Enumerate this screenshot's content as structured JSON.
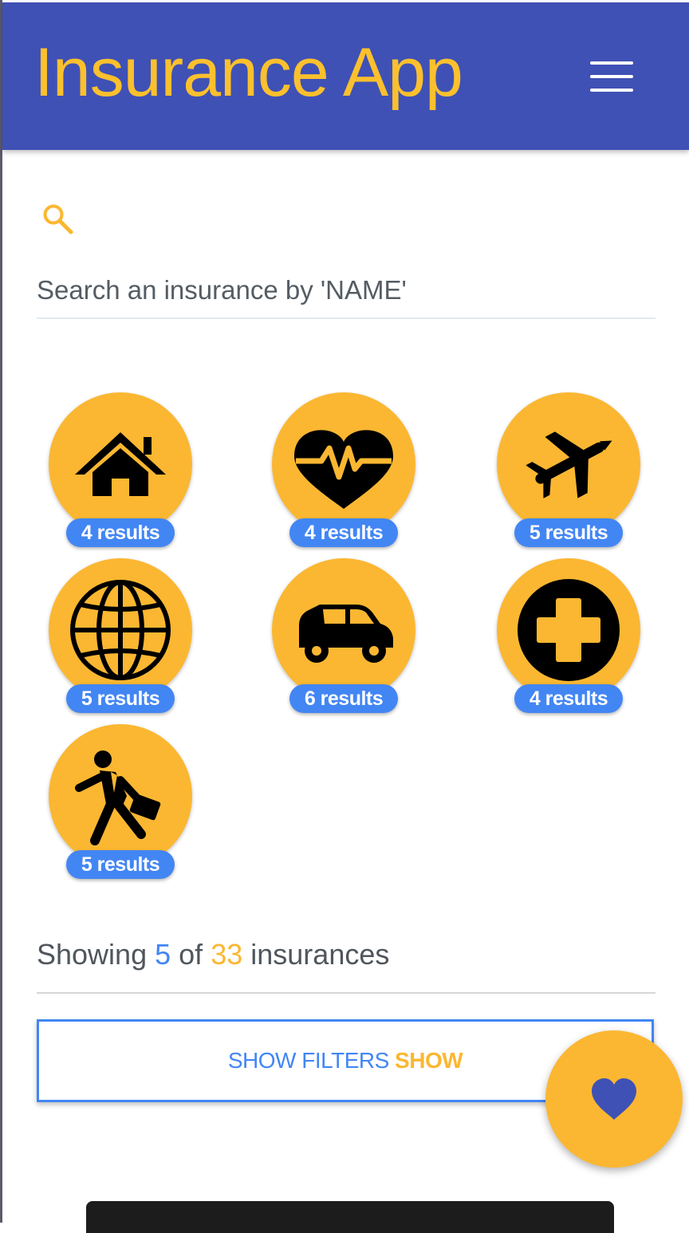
{
  "header": {
    "title": "Insurance App",
    "menu_icon": "hamburger-menu-icon",
    "background_color": "#3f51b5",
    "title_color": "#fbc02d"
  },
  "search": {
    "icon": "search-icon",
    "placeholder": "Search an insurance by 'NAME'",
    "value": ""
  },
  "categories": [
    {
      "icon": "home-icon",
      "results": "4 results"
    },
    {
      "icon": "heart-pulse-icon",
      "results": "4 results"
    },
    {
      "icon": "airplane-icon",
      "results": "5 results"
    },
    {
      "icon": "globe-icon",
      "results": "5 results"
    },
    {
      "icon": "car-icon",
      "results": "6 results"
    },
    {
      "icon": "medical-cross-icon",
      "results": "4 results"
    },
    {
      "icon": "businessman-icon",
      "results": "5 results"
    }
  ],
  "summary": {
    "prefix": "Showing",
    "shown": "5",
    "middle": "of",
    "total": "33",
    "suffix": "insurances"
  },
  "filters_button": {
    "label": "SHOW FILTERS",
    "state": "SHOW"
  },
  "fab": {
    "icon": "heart-icon"
  },
  "colors": {
    "accent_amber": "#fbb731",
    "accent_blue": "#4286f4",
    "heart_blue": "#3f51b5"
  }
}
